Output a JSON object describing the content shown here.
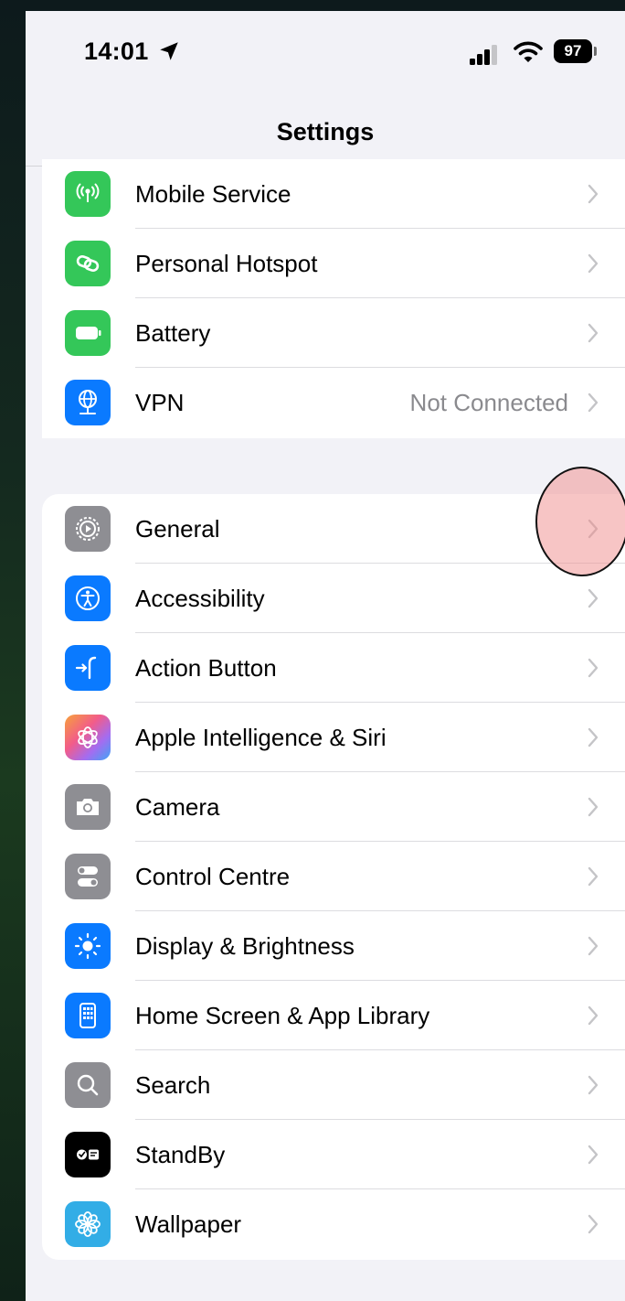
{
  "status": {
    "time": "14:01",
    "battery": "97"
  },
  "nav": {
    "title": "Settings"
  },
  "group_a": [
    {
      "label": "Mobile Service",
      "value": "",
      "icon": "antenna-icon",
      "color": "#34c759"
    },
    {
      "label": "Personal Hotspot",
      "value": "",
      "icon": "hotspot-link-icon",
      "color": "#34c759"
    },
    {
      "label": "Battery",
      "value": "",
      "icon": "battery-icon",
      "color": "#34c759"
    },
    {
      "label": "VPN",
      "value": "Not Connected",
      "icon": "globe-network-icon",
      "color": "#0a7aff"
    }
  ],
  "group_b": [
    {
      "label": "General",
      "icon": "gear-icon",
      "color": "#8e8e93"
    },
    {
      "label": "Accessibility",
      "icon": "accessibility-person-icon",
      "color": "#0a7aff"
    },
    {
      "label": "Action Button",
      "icon": "action-button-icon",
      "color": "#0a7aff"
    },
    {
      "label": "Apple Intelligence & Siri",
      "icon": "apple-intelligence-icon",
      "color": "#ff6b6b"
    },
    {
      "label": "Camera",
      "icon": "camera-icon",
      "color": "#8e8e93"
    },
    {
      "label": "Control Centre",
      "icon": "toggles-icon",
      "color": "#8e8e93"
    },
    {
      "label": "Display & Brightness",
      "icon": "sun-icon",
      "color": "#0a7aff"
    },
    {
      "label": "Home Screen & App Library",
      "icon": "home-screen-icon",
      "color": "#0a7aff"
    },
    {
      "label": "Search",
      "icon": "search-icon",
      "color": "#8e8e93"
    },
    {
      "label": "StandBy",
      "icon": "standby-icon",
      "color": "#000000"
    },
    {
      "label": "Wallpaper",
      "icon": "wallpaper-flower-icon",
      "color": "#32ade6"
    }
  ]
}
